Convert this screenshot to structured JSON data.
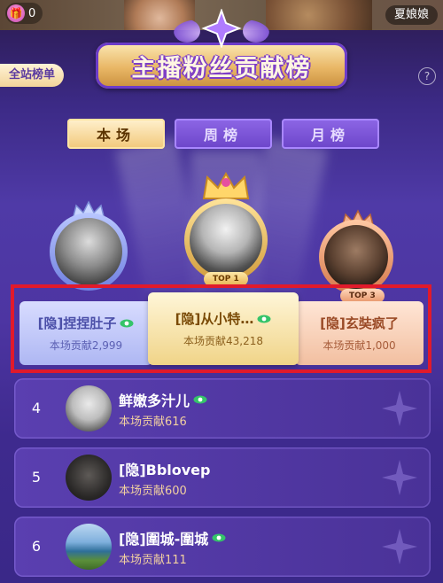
{
  "topbar": {
    "gift_count": "0",
    "username": "夏娘娘"
  },
  "header": {
    "title": "主播粉丝贡献榜",
    "site_rank_label": "全站榜单",
    "help_label": "?"
  },
  "tabs": [
    {
      "label": "本场",
      "active": true
    },
    {
      "label": "周榜",
      "active": false
    },
    {
      "label": "月榜",
      "active": false
    }
  ],
  "top3": [
    {
      "rank_label": "TOP 1",
      "name": "[隐]从小特…",
      "contribution": "本场贡献43,218"
    },
    {
      "rank_label": "",
      "name": "[隐]捏捏肚子",
      "contribution": "本场贡献2,999"
    },
    {
      "rank_label": "TOP 3",
      "name": "[隐]玄奘疯了",
      "contribution": "本场贡献1,000"
    }
  ],
  "list": [
    {
      "rank": "4",
      "name": "鲜嫩多汁儿",
      "contribution": "本场贡献616",
      "eye": true
    },
    {
      "rank": "5",
      "name": "[隐]Bblovep",
      "contribution": "本场贡献600",
      "eye": false
    },
    {
      "rank": "6",
      "name": "[隐]圍城-圍城",
      "contribution": "本场贡献111",
      "eye": true
    }
  ],
  "colors": {
    "eye": "#35c46a",
    "contribution_list": "#f2d0a0",
    "highlight": "#e11a2b"
  }
}
